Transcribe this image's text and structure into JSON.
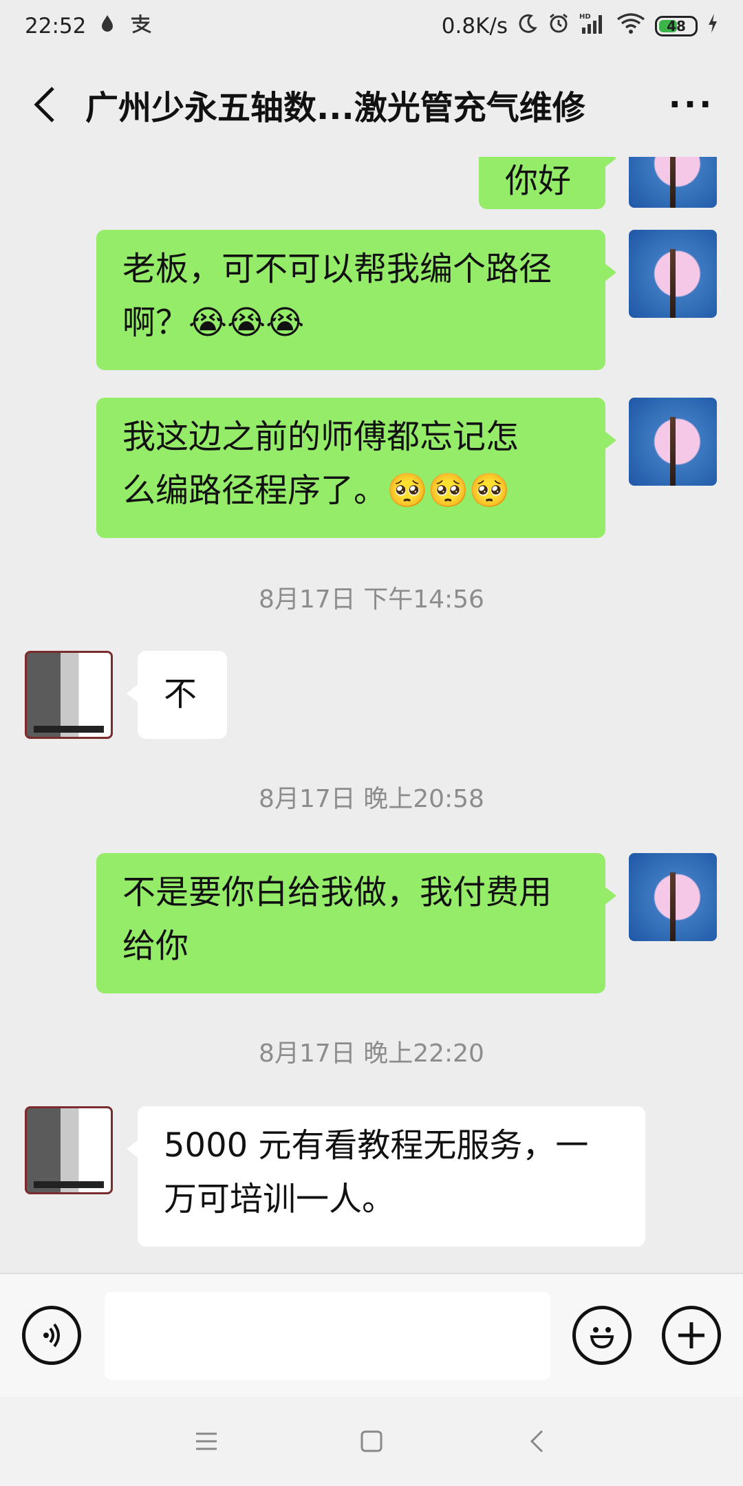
{
  "status_bar": {
    "time": "22:52",
    "net_speed": "0.8K/s",
    "battery": "48"
  },
  "header": {
    "title": "广州少永五轴数...激光管充气维修",
    "more": "···"
  },
  "messages": [
    {
      "text": "你好"
    },
    {
      "text": "老板，可不可以帮我编个路径",
      "text2": "啊？",
      "emoji": "😭😭😭"
    },
    {
      "text": "我这边之前的师傅都忘记怎",
      "text2": "么编路径程序了。",
      "emoji": "🥺🥺🥺"
    },
    {
      "text": "不"
    },
    {
      "text": "不是要你白给我做，我付费用",
      "text2": "给你"
    },
    {
      "text": "5000 元有看教程无服务，一",
      "text2": "万可培训一人。"
    }
  ],
  "timestamps": [
    "8月17日 下午14:56",
    "8月17日 晚上20:58",
    "8月17日 晚上22:20"
  ],
  "input": {
    "placeholder": ""
  },
  "colors": {
    "bubble_sent": "#95ec69",
    "bubble_received": "#ffffff",
    "background": "#ededed"
  }
}
